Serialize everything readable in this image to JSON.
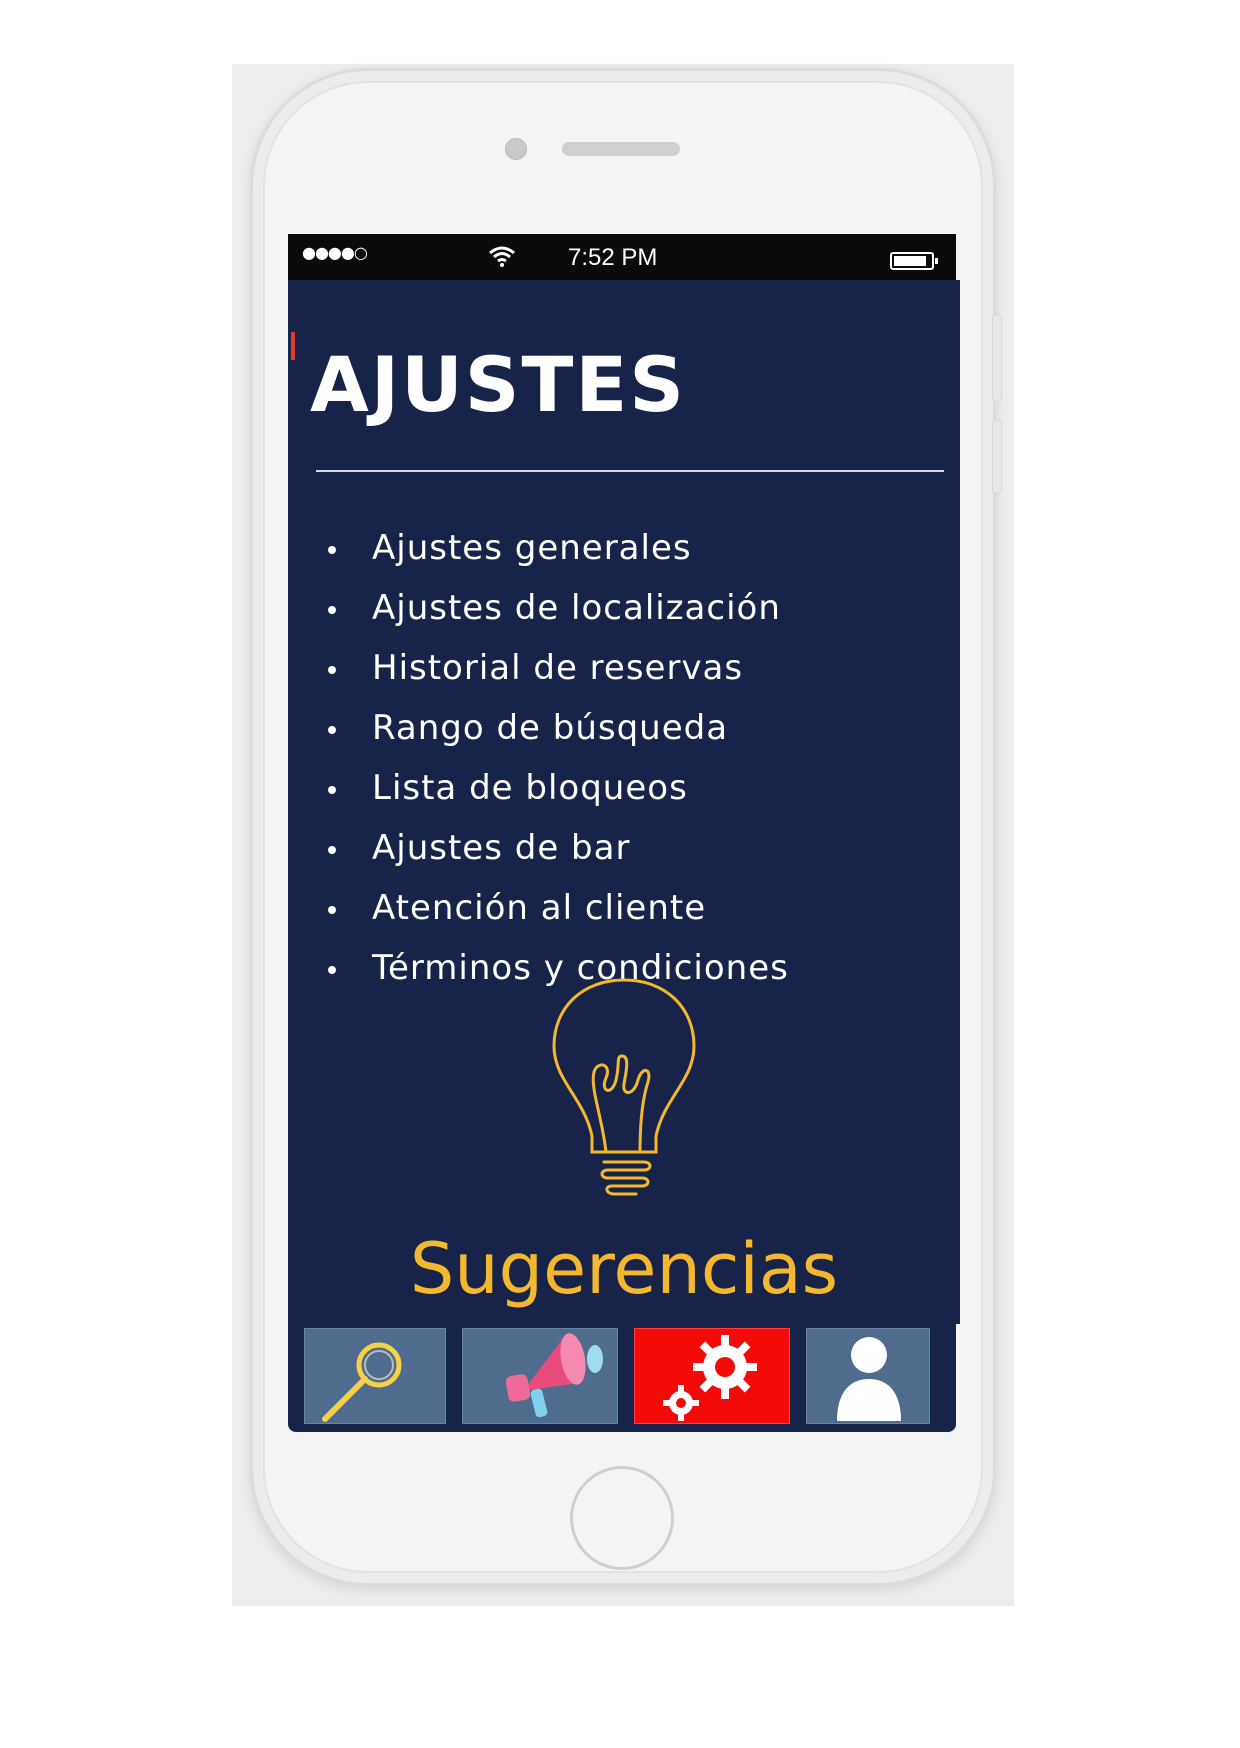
{
  "statusbar": {
    "signal": "●●●●○",
    "time": "7:52 PM",
    "battery_level": 0.9,
    "wifi_icon": "wifi-icon"
  },
  "page": {
    "title": "AJUSTES",
    "menu_items": [
      "Ajustes generales",
      "Ajustes de localización",
      "Historial de reservas",
      "Rango de búsqueda",
      "Lista de bloqueos",
      "Ajustes de bar",
      "Atención al cliente",
      "Términos y condiciones"
    ],
    "suggestion_icon": "lightbulb-icon",
    "suggestion_label": "Sugerencias"
  },
  "tabbar": {
    "tabs": [
      {
        "icon": "search-icon",
        "active": false
      },
      {
        "icon": "megaphone-icon",
        "active": false
      },
      {
        "icon": "gears-icon",
        "active": true
      },
      {
        "icon": "user-icon",
        "active": false
      }
    ]
  },
  "colors": {
    "panel": "#172348",
    "accent_gold": "#f4b82e",
    "tab": "#4f6b8d",
    "tab_active": "#f50a0a"
  }
}
